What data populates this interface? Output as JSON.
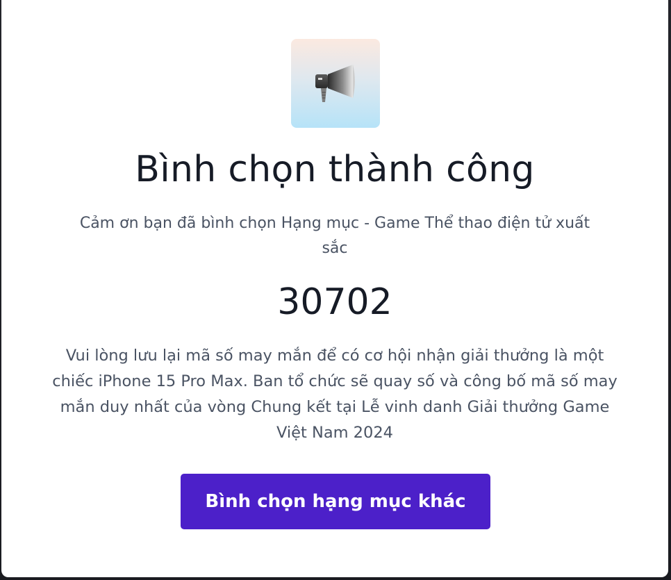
{
  "modal": {
    "icon": "megaphone-icon",
    "title": "Bình chọn thành công",
    "subtitle": "Cảm ơn bạn đã bình chọn Hạng mục - Game Thể thao điện tử xuất sắc",
    "lucky_code": "30702",
    "description": "Vui lòng lưu lại mã số may mắn để có cơ hội nhận giải thưởng là một chiếc iPhone 15 Pro Max. Ban tổ chức sẽ quay số và công bố mã số may mắn duy nhất của vòng Chung kết tại Lễ vinh danh Giải thưởng Game Việt Nam 2024",
    "cta_label": "Bình chọn hạng mục khác"
  },
  "colors": {
    "cta_background": "#4c20c9",
    "heading_text": "#161b26",
    "body_text": "#4a5363"
  }
}
